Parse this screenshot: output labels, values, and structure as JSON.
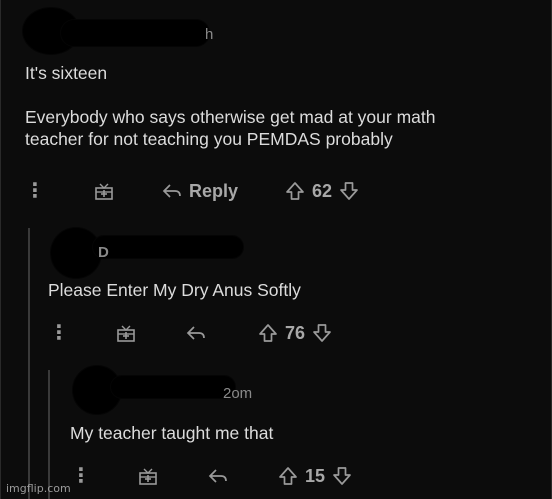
{
  "comments": [
    {
      "author_fragment": "h",
      "body_lines": [
        "It's sixteen",
        "",
        "Everybody who says otherwise get mad at your math",
        "teacher for not teaching you PEMDAS probably"
      ],
      "reply_label": "Reply",
      "score": "62"
    },
    {
      "author_fragment": "D",
      "body_lines": [
        "Please Enter My Dry Anus Softly"
      ],
      "score": "76"
    },
    {
      "author_fragment": "2om",
      "body_lines": [
        "My teacher taught me that"
      ],
      "score": "15"
    }
  ],
  "icons": {
    "more": "more-options-icon",
    "award": "award-icon",
    "reply": "reply-arrow-icon",
    "upvote": "upvote-icon",
    "downvote": "downvote-icon"
  },
  "watermark": "imgflip.com"
}
